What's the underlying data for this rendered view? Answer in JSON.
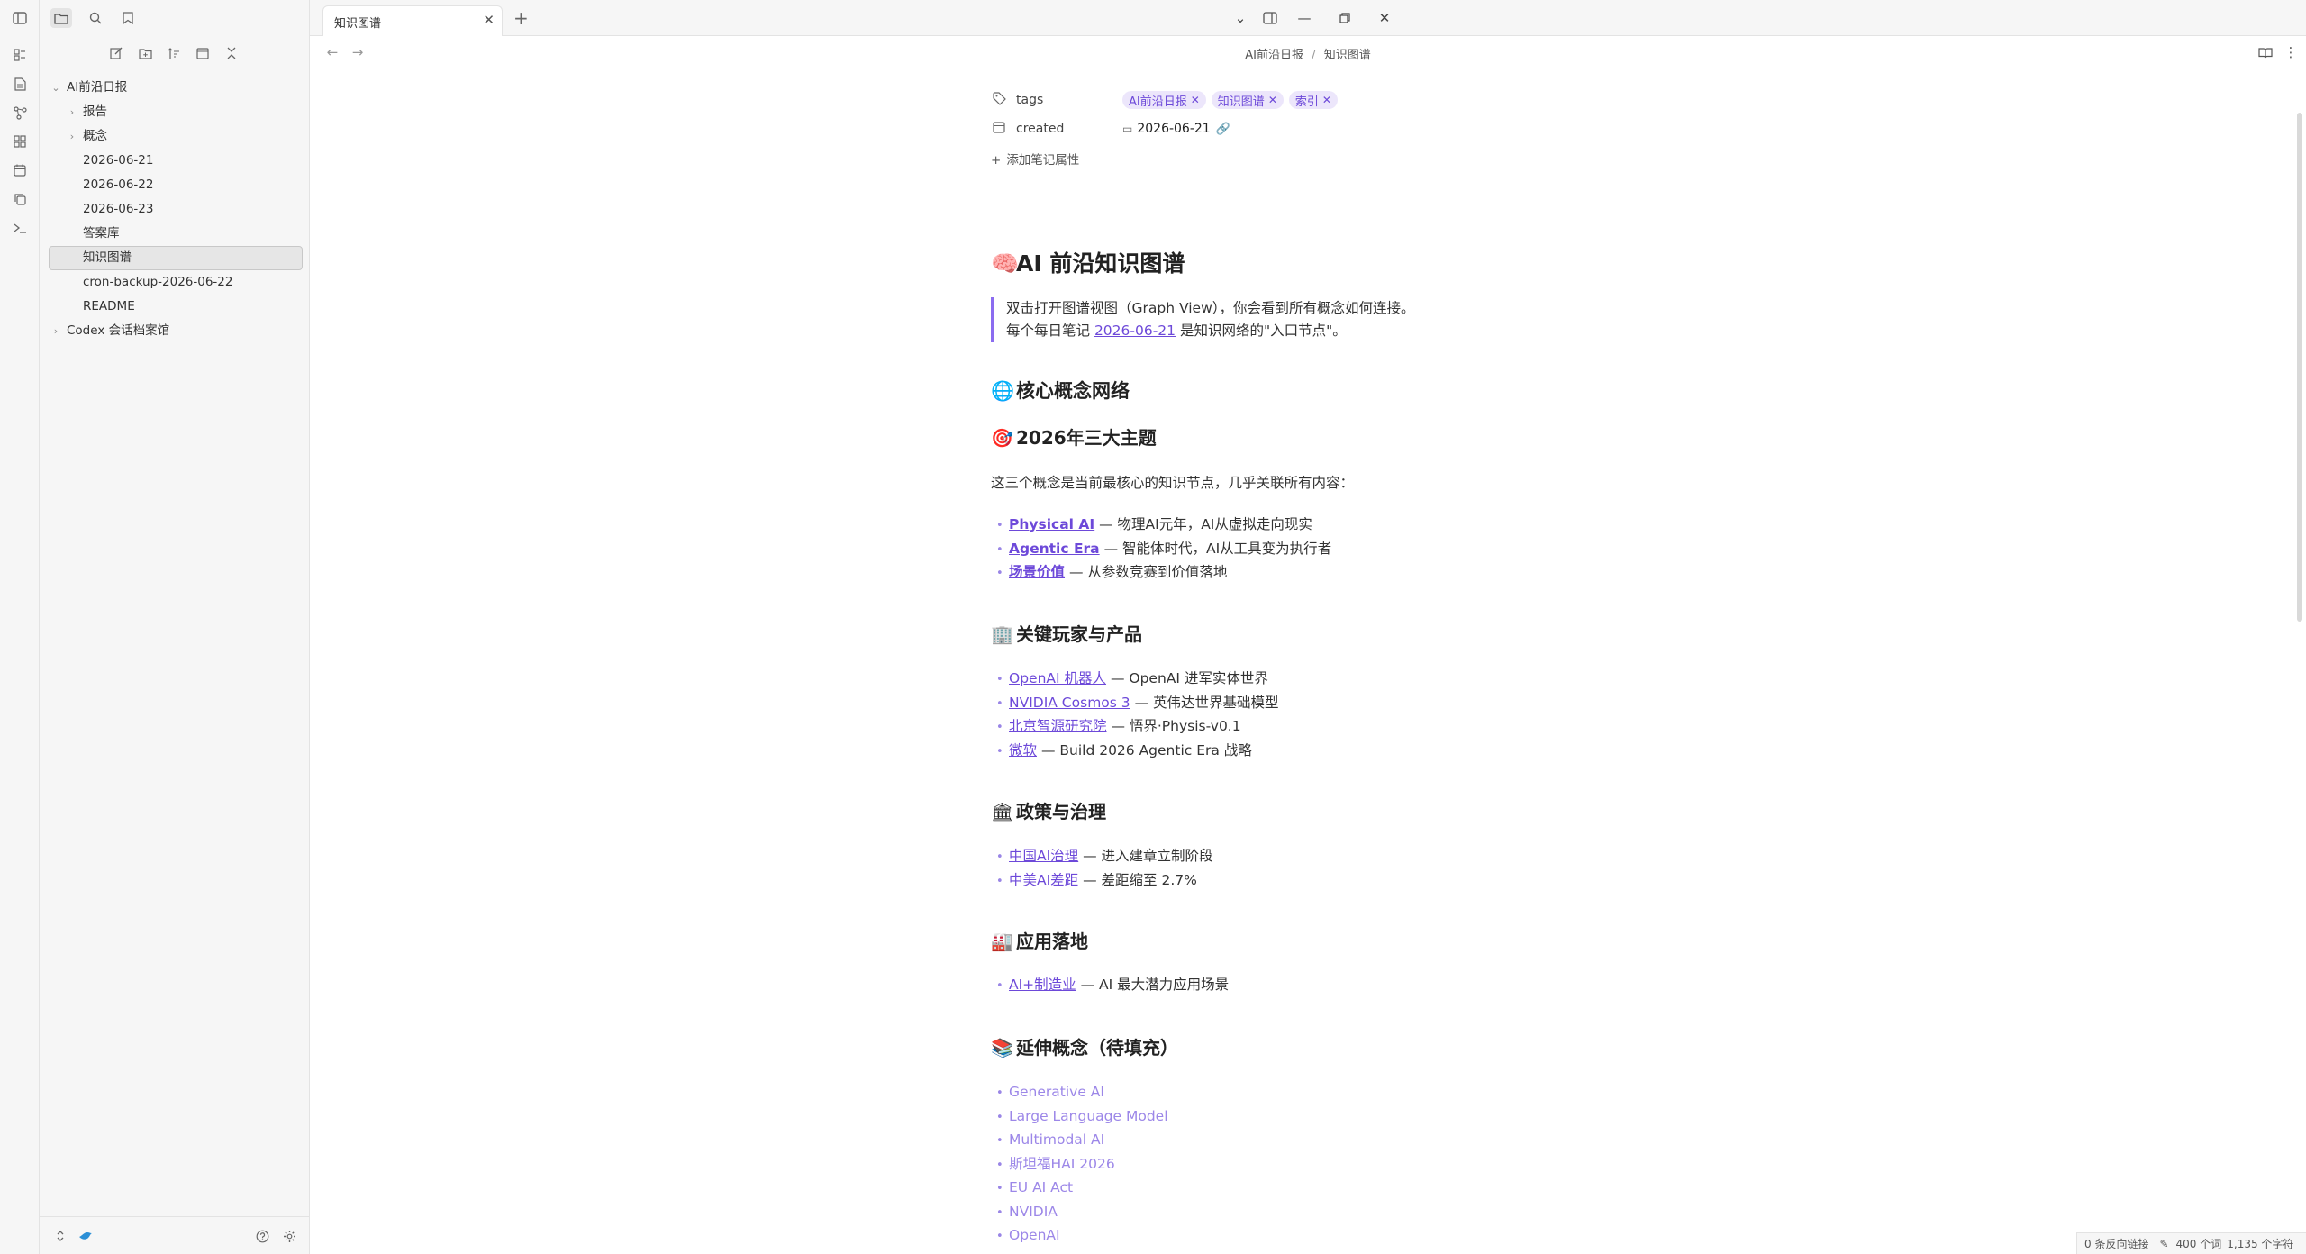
{
  "ribbon": {
    "icons": [
      "sidebar-toggle-icon",
      "files-icon",
      "document-icon",
      "graph-icon",
      "grid-icon",
      "calendar-icon",
      "copy-icon",
      "terminal-icon"
    ]
  },
  "sidebar": {
    "tree": [
      {
        "label": "AI前沿日报",
        "type": "folder",
        "expanded": true,
        "depth": 0
      },
      {
        "label": "报告",
        "type": "folder",
        "expanded": false,
        "depth": 1
      },
      {
        "label": "概念",
        "type": "folder",
        "expanded": false,
        "depth": 1
      },
      {
        "label": "2026-06-21",
        "type": "file",
        "depth": 1
      },
      {
        "label": "2026-06-22",
        "type": "file",
        "depth": 1
      },
      {
        "label": "2026-06-23",
        "type": "file",
        "depth": 1
      },
      {
        "label": "答案库",
        "type": "file",
        "depth": 1
      },
      {
        "label": "知识图谱",
        "type": "file",
        "depth": 1,
        "selected": true
      },
      {
        "label": "cron-backup-2026-06-22",
        "type": "file",
        "depth": 1
      },
      {
        "label": "README",
        "type": "file",
        "depth": 1
      },
      {
        "label": "Codex 会话档案馆",
        "type": "folder",
        "expanded": false,
        "depth": 0
      }
    ]
  },
  "tabs": {
    "active_title": "知识图谱"
  },
  "breadcrumb": {
    "folder": "AI前沿日报",
    "separator": "/",
    "file": "知识图谱"
  },
  "properties": {
    "tags_label": "tags",
    "tags": [
      "AI前沿日报",
      "知识图谱",
      "索引"
    ],
    "created_label": "created",
    "created_value": "2026-06-21",
    "add_label": "添加笔记属性"
  },
  "doc": {
    "title_emoji": "🧠",
    "title": "AI 前沿知识图谱",
    "quote_line1": "双击打开图谱视图（Graph View），你会看到所有概念如何连接。",
    "quote_line2_pre": "每个每日笔记 ",
    "quote_line2_link": "2026-06-21",
    "quote_line2_post": " 是知识网络的\"入口节点\"。",
    "h2_network_emoji": "🌐",
    "h2_network": "核心概念网络",
    "h3_themes_emoji": "🎯",
    "h3_themes": "2026年三大主题",
    "themes_intro": "这三个概念是当前最核心的知识节点，几乎关联所有内容：",
    "themes": [
      {
        "link": "Physical AI",
        "desc": " — 物理AI元年，AI从虚拟走向现实"
      },
      {
        "link": "Agentic Era",
        "desc": " — 智能体时代，AI从工具变为执行者"
      },
      {
        "link": "场景价值",
        "desc": " — 从参数竞赛到价值落地"
      }
    ],
    "h3_players_emoji": "🏢",
    "h3_players": "关键玩家与产品",
    "players": [
      {
        "link": "OpenAI 机器人",
        "desc": " — OpenAI 进军实体世界"
      },
      {
        "link": "NVIDIA Cosmos 3",
        "desc": " — 英伟达世界基础模型"
      },
      {
        "link": "北京智源研究院",
        "desc": " — 悟界·Physis-v0.1"
      },
      {
        "link": "微软",
        "desc": " — Build 2026 Agentic Era 战略"
      }
    ],
    "h3_policy_emoji": "🏛",
    "h3_policy": "政策与治理",
    "policy": [
      {
        "link": "中国AI治理",
        "desc": " — 进入建章立制阶段"
      },
      {
        "link": "中美AI差距",
        "desc": " — 差距缩至 2.7%"
      }
    ],
    "h3_apps_emoji": "🏭",
    "h3_apps": "应用落地",
    "apps": [
      {
        "link": "AI+制造业",
        "desc": " — AI 最大潜力应用场景"
      }
    ],
    "h3_ext_emoji": "📚",
    "h3_ext": "延伸概念（待填充）",
    "ext": [
      "Generative AI",
      "Large Language Model",
      "Multimodal AI",
      "斯坦福HAI 2026",
      "EU AI Act",
      "NVIDIA",
      "OpenAI"
    ]
  },
  "status": {
    "backlinks": "0 条反向链接",
    "words": "400 个词",
    "chars": "1,135 个字符"
  }
}
